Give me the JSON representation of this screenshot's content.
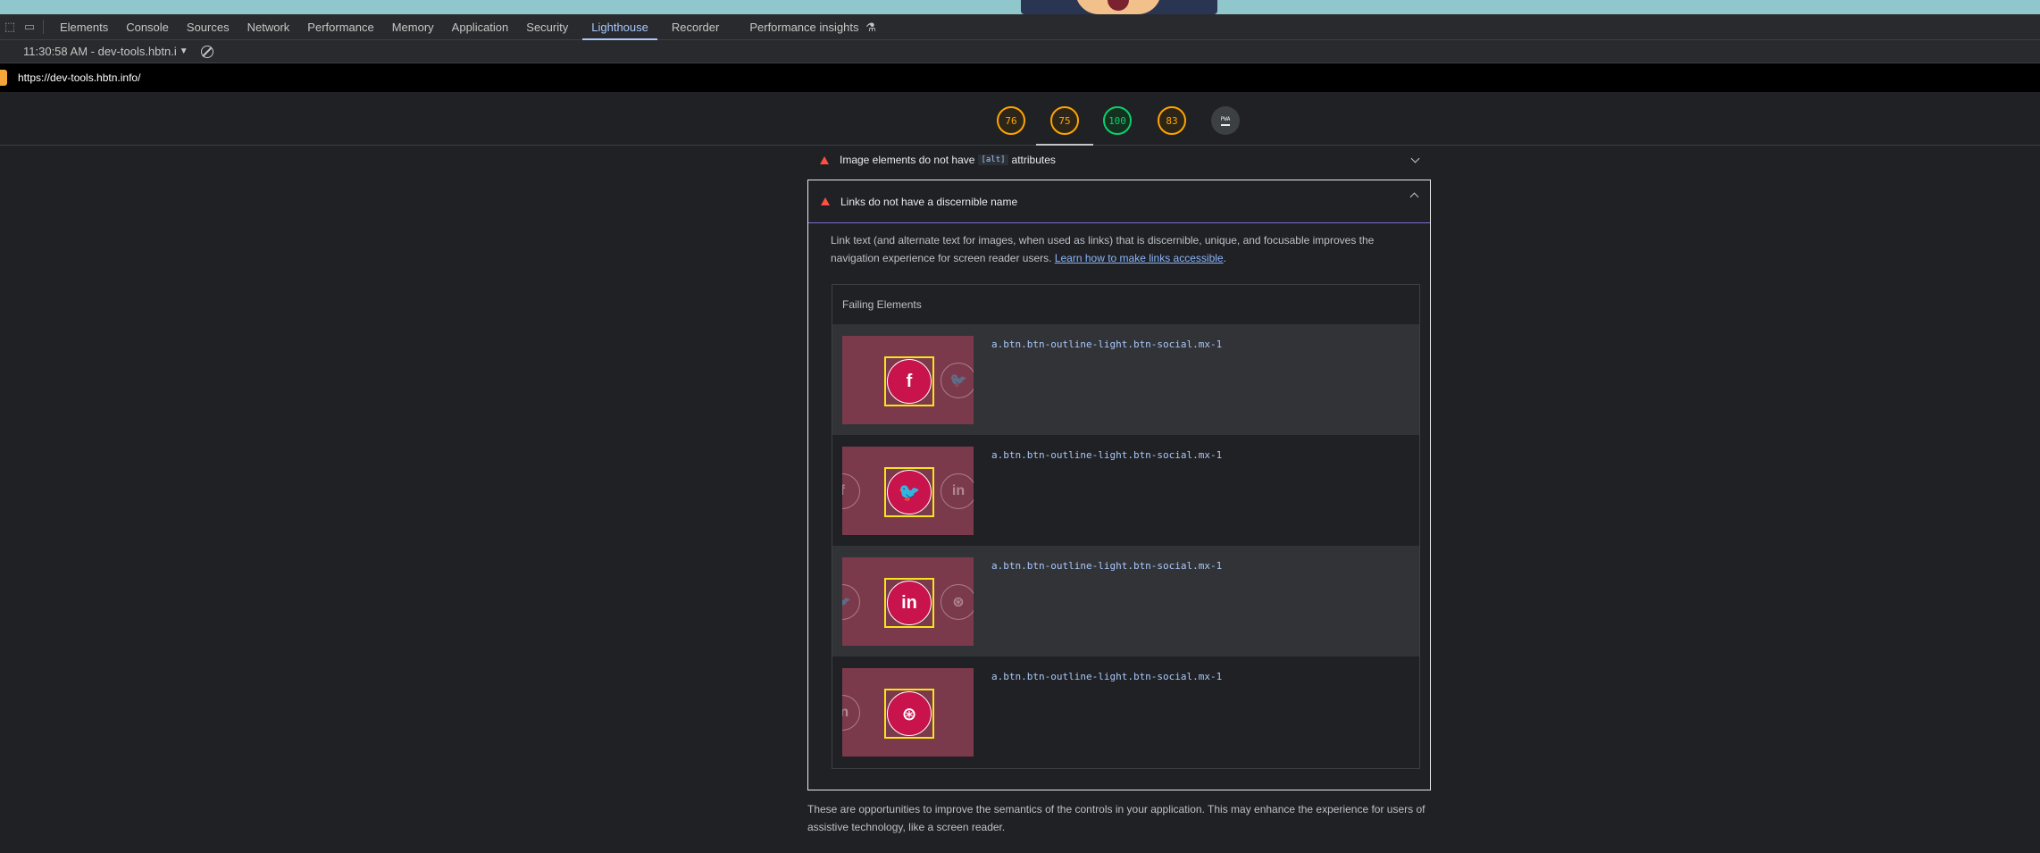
{
  "devtools": {
    "tabs": [
      {
        "label": "Elements"
      },
      {
        "label": "Console"
      },
      {
        "label": "Sources"
      },
      {
        "label": "Network"
      },
      {
        "label": "Performance"
      },
      {
        "label": "Memory"
      },
      {
        "label": "Application"
      },
      {
        "label": "Security"
      },
      {
        "label": "Lighthouse",
        "active": true
      },
      {
        "label": "Recorder"
      },
      {
        "label": "Performance insights"
      }
    ],
    "lighthouse_toolbar": {
      "report_label": "11:30:58 AM - dev-tools.hbtn.i"
    },
    "url": "https://dev-tools.hbtn.info/"
  },
  "scores": [
    {
      "value": "76",
      "status": "average"
    },
    {
      "value": "75",
      "status": "average"
    },
    {
      "value": "100",
      "status": "pass"
    },
    {
      "value": "83",
      "status": "average"
    },
    {
      "value": "PWA",
      "status": "pwa"
    }
  ],
  "audits": {
    "collapsed": {
      "title_before": "Image elements do not have",
      "code": "[alt]",
      "title_after": "attributes"
    },
    "expanded": {
      "title": "Links do not have a discernible name",
      "description": "Link text (and alternate text for images, when used as links) that is discernible, unique, and focusable improves the navigation experience for screen reader users.",
      "link_text": "Learn how to make links accessible",
      "failing_title": "Failing Elements",
      "items": [
        {
          "selector": "a.btn.btn-outline-light.btn-social.mx-1",
          "icon": "f",
          "left": "",
          "right": "twitter"
        },
        {
          "selector": "a.btn.btn-outline-light.btn-social.mx-1",
          "icon": "twitter",
          "left": "f",
          "right": "in"
        },
        {
          "selector": "a.btn.btn-outline-light.btn-social.mx-1",
          "icon": "in",
          "left": "twitter",
          "right": "dribbble"
        },
        {
          "selector": "a.btn.btn-outline-light.btn-social.mx-1",
          "icon": "dribbble",
          "left": "in",
          "right": ""
        }
      ]
    }
  },
  "footer": "These are opportunities to improve the semantics of the controls in your application. This may enhance the experience for users of assistive technology, like a screen reader.",
  "colors": {
    "average": "#ffa400",
    "pass": "#0cce6b",
    "fail": "#ff4e42",
    "accent": "#a8c7fa"
  }
}
